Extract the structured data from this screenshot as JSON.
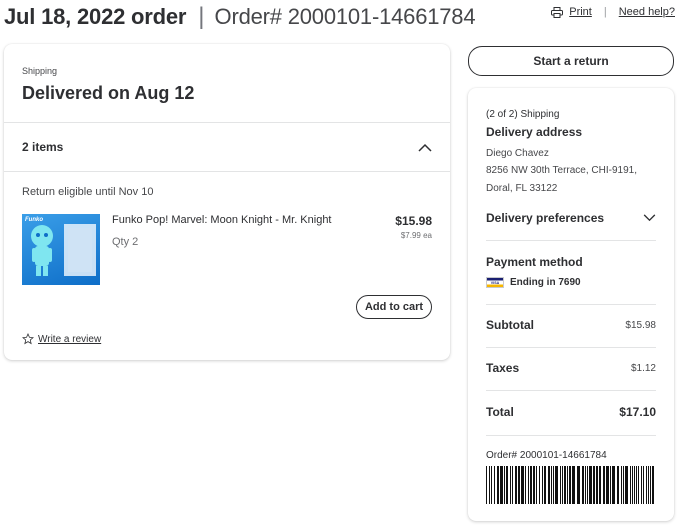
{
  "header": {
    "order_date": "Jul 18, 2022 order",
    "separator": "|",
    "order_number": "Order# 2000101-14661784",
    "print_label": "Print",
    "link_separator": "|",
    "help_label": "Need help?",
    "print_icon": "printer-icon"
  },
  "shipment": {
    "label": "Shipping",
    "status": "Delivered on Aug 12",
    "items_count": "2 items",
    "collapse_icon": "chevron-up-icon",
    "return_eligibility": "Return eligible until Nov 10"
  },
  "product": {
    "name": "Funko Pop! Marvel: Moon Knight - Mr. Knight",
    "qty": "Qty 2",
    "price": "$15.98",
    "unit_price": "$7.99 ea",
    "add_to_cart_label": "Add to cart",
    "image_brand_text": "Funko",
    "image_colors": {
      "bg_top": "#3a9ee8",
      "bg_bottom": "#0e6ec8",
      "figure": "#7fe6f0"
    }
  },
  "review": {
    "icon": "star-icon",
    "label": "Write a review"
  },
  "actions": {
    "start_return_label": "Start a return"
  },
  "summary": {
    "shipment_count": "(2 of 2) Shipping",
    "address_title": "Delivery address",
    "address_name": "Diego Chavez",
    "address_line1": "8256 NW 30th Terrace, CHI-9191,",
    "address_line2": "Doral, FL 33122",
    "delivery_prefs_label": "Delivery preferences",
    "delivery_prefs_icon": "chevron-down-icon",
    "payment_title": "Payment method",
    "card_brand_icon": "visa-card-icon",
    "card_text": "Ending in 7690",
    "subtotal_label": "Subtotal",
    "subtotal_value": "$15.98",
    "taxes_label": "Taxes",
    "taxes_value": "$1.12",
    "total_label": "Total",
    "total_value": "$17.10",
    "order_number_footer": "Order# 2000101-14661784"
  },
  "colors": {
    "text": "#2e2f32",
    "muted": "#46474a",
    "divider": "#e3e4e5",
    "visa_blue": "#1a1f71",
    "visa_gold": "#f7b600"
  }
}
